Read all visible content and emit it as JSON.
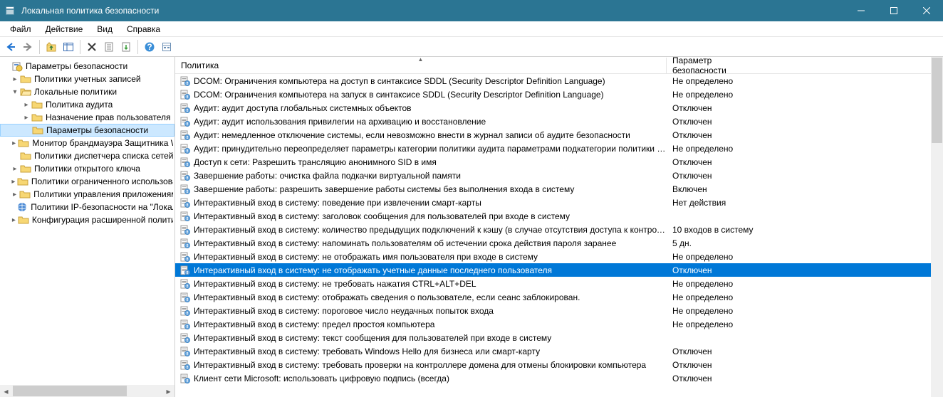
{
  "window": {
    "title": "Локальная политика безопасности"
  },
  "menu": {
    "file": "Файл",
    "action": "Действие",
    "view": "Вид",
    "help": "Справка"
  },
  "tree": {
    "root": "Параметры безопасности",
    "n0": "Политики учетных записей",
    "n1": "Локальные политики",
    "n1_0": "Политика аудита",
    "n1_1": "Назначение прав пользователя",
    "n1_2": "Параметры безопасности",
    "n2": "Монитор брандмауэра Защитника Windows",
    "n3": "Политики диспетчера списка сетей",
    "n4": "Политики открытого ключа",
    "n5": "Политики ограниченного использования программ",
    "n6": "Политики управления приложениями",
    "n7": "Политики IP-безопасности на \"Локальный компьютер\"",
    "n8": "Конфигурация расширенной политики аудита"
  },
  "columns": {
    "c1": "Политика",
    "c2": "Параметр безопасности"
  },
  "rows": [
    {
      "p": "DCOM: Ограничения компьютера на доступ в синтаксисе SDDL (Security Descriptor Definition Language)",
      "v": "Не определено"
    },
    {
      "p": "DCOM: Ограничения компьютера на запуск в синтаксисе SDDL (Security Descriptor Definition Language)",
      "v": "Не определено"
    },
    {
      "p": "Аудит: аудит доступа глобальных системных объектов",
      "v": "Отключен"
    },
    {
      "p": "Аудит: аудит использования привилегии на архивацию и восстановление",
      "v": "Отключен"
    },
    {
      "p": "Аудит: немедленное отключение системы, если невозможно внести в журнал записи об аудите безопасности",
      "v": "Отключен"
    },
    {
      "p": "Аудит: принудительно переопределяет параметры категории политики аудита параметрами подкатегории политики ау...",
      "v": "Не определено"
    },
    {
      "p": "Доступ к сети: Разрешить трансляцию анонимного SID в имя",
      "v": "Отключен"
    },
    {
      "p": "Завершение работы: очистка файла подкачки виртуальной памяти",
      "v": "Отключен"
    },
    {
      "p": "Завершение работы: разрешить завершение работы системы без выполнения входа в систему",
      "v": "Включен"
    },
    {
      "p": "Интерактивный вход в систему:  поведение при извлечении смарт-карты",
      "v": "Нет действия"
    },
    {
      "p": "Интерактивный вход в систему: заголовок сообщения для пользователей при входе в систему",
      "v": ""
    },
    {
      "p": "Интерактивный вход в систему: количество предыдущих подключений к кэшу (в случае отсутствия доступа к контрол...",
      "v": "10 входов в систему"
    },
    {
      "p": "Интерактивный вход в систему: напоминать пользователям об истечении срока действия пароля заранее",
      "v": "5 дн."
    },
    {
      "p": "Интерактивный вход в систему: не отображать имя пользователя при входе в систему",
      "v": "Не определено"
    },
    {
      "p": "Интерактивный вход в систему: не отображать учетные данные последнего пользователя",
      "v": "Отключен",
      "sel": true
    },
    {
      "p": "Интерактивный вход в систему: не требовать нажатия CTRL+ALT+DEL",
      "v": "Не определено"
    },
    {
      "p": "Интерактивный вход в систему: отображать сведения о пользователе, если сеанс заблокирован.",
      "v": "Не определено"
    },
    {
      "p": "Интерактивный вход в систему: пороговое число неудачных попыток входа",
      "v": "Не определено"
    },
    {
      "p": "Интерактивный вход в систему: предел простоя компьютера",
      "v": "Не определено"
    },
    {
      "p": "Интерактивный вход в систему: текст сообщения для пользователей при входе в систему",
      "v": ""
    },
    {
      "p": "Интерактивный вход в систему: требовать Windows Hello для бизнеса или смарт-карту",
      "v": "Отключен"
    },
    {
      "p": "Интерактивный вход в систему: требовать проверки на контроллере домена для отмены блокировки компьютера",
      "v": "Отключен"
    },
    {
      "p": "Клиент сети Microsoft: использовать цифровую подпись (всегда)",
      "v": "Отключен"
    }
  ]
}
